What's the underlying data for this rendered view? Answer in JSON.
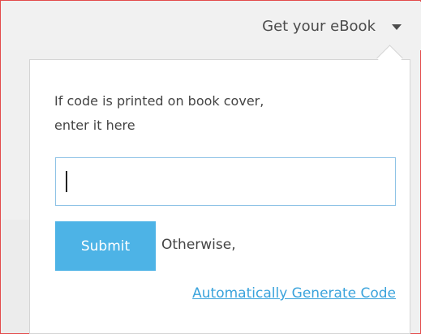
{
  "header": {
    "ebook_label": "Get your eBook",
    "caret_icon": "caret-down-icon"
  },
  "popup": {
    "instruction_line1": "If code is printed on book cover,",
    "instruction_line2": "enter it here",
    "code_input_value": "",
    "submit_label": "Submit",
    "otherwise_text": "Otherwise,",
    "generate_link_label": "Automatically Generate Code"
  },
  "colors": {
    "accent": "#4db3e6",
    "link": "#3aa3dc",
    "input_border": "#8fc3e6",
    "frame_border": "#e34b4b"
  }
}
